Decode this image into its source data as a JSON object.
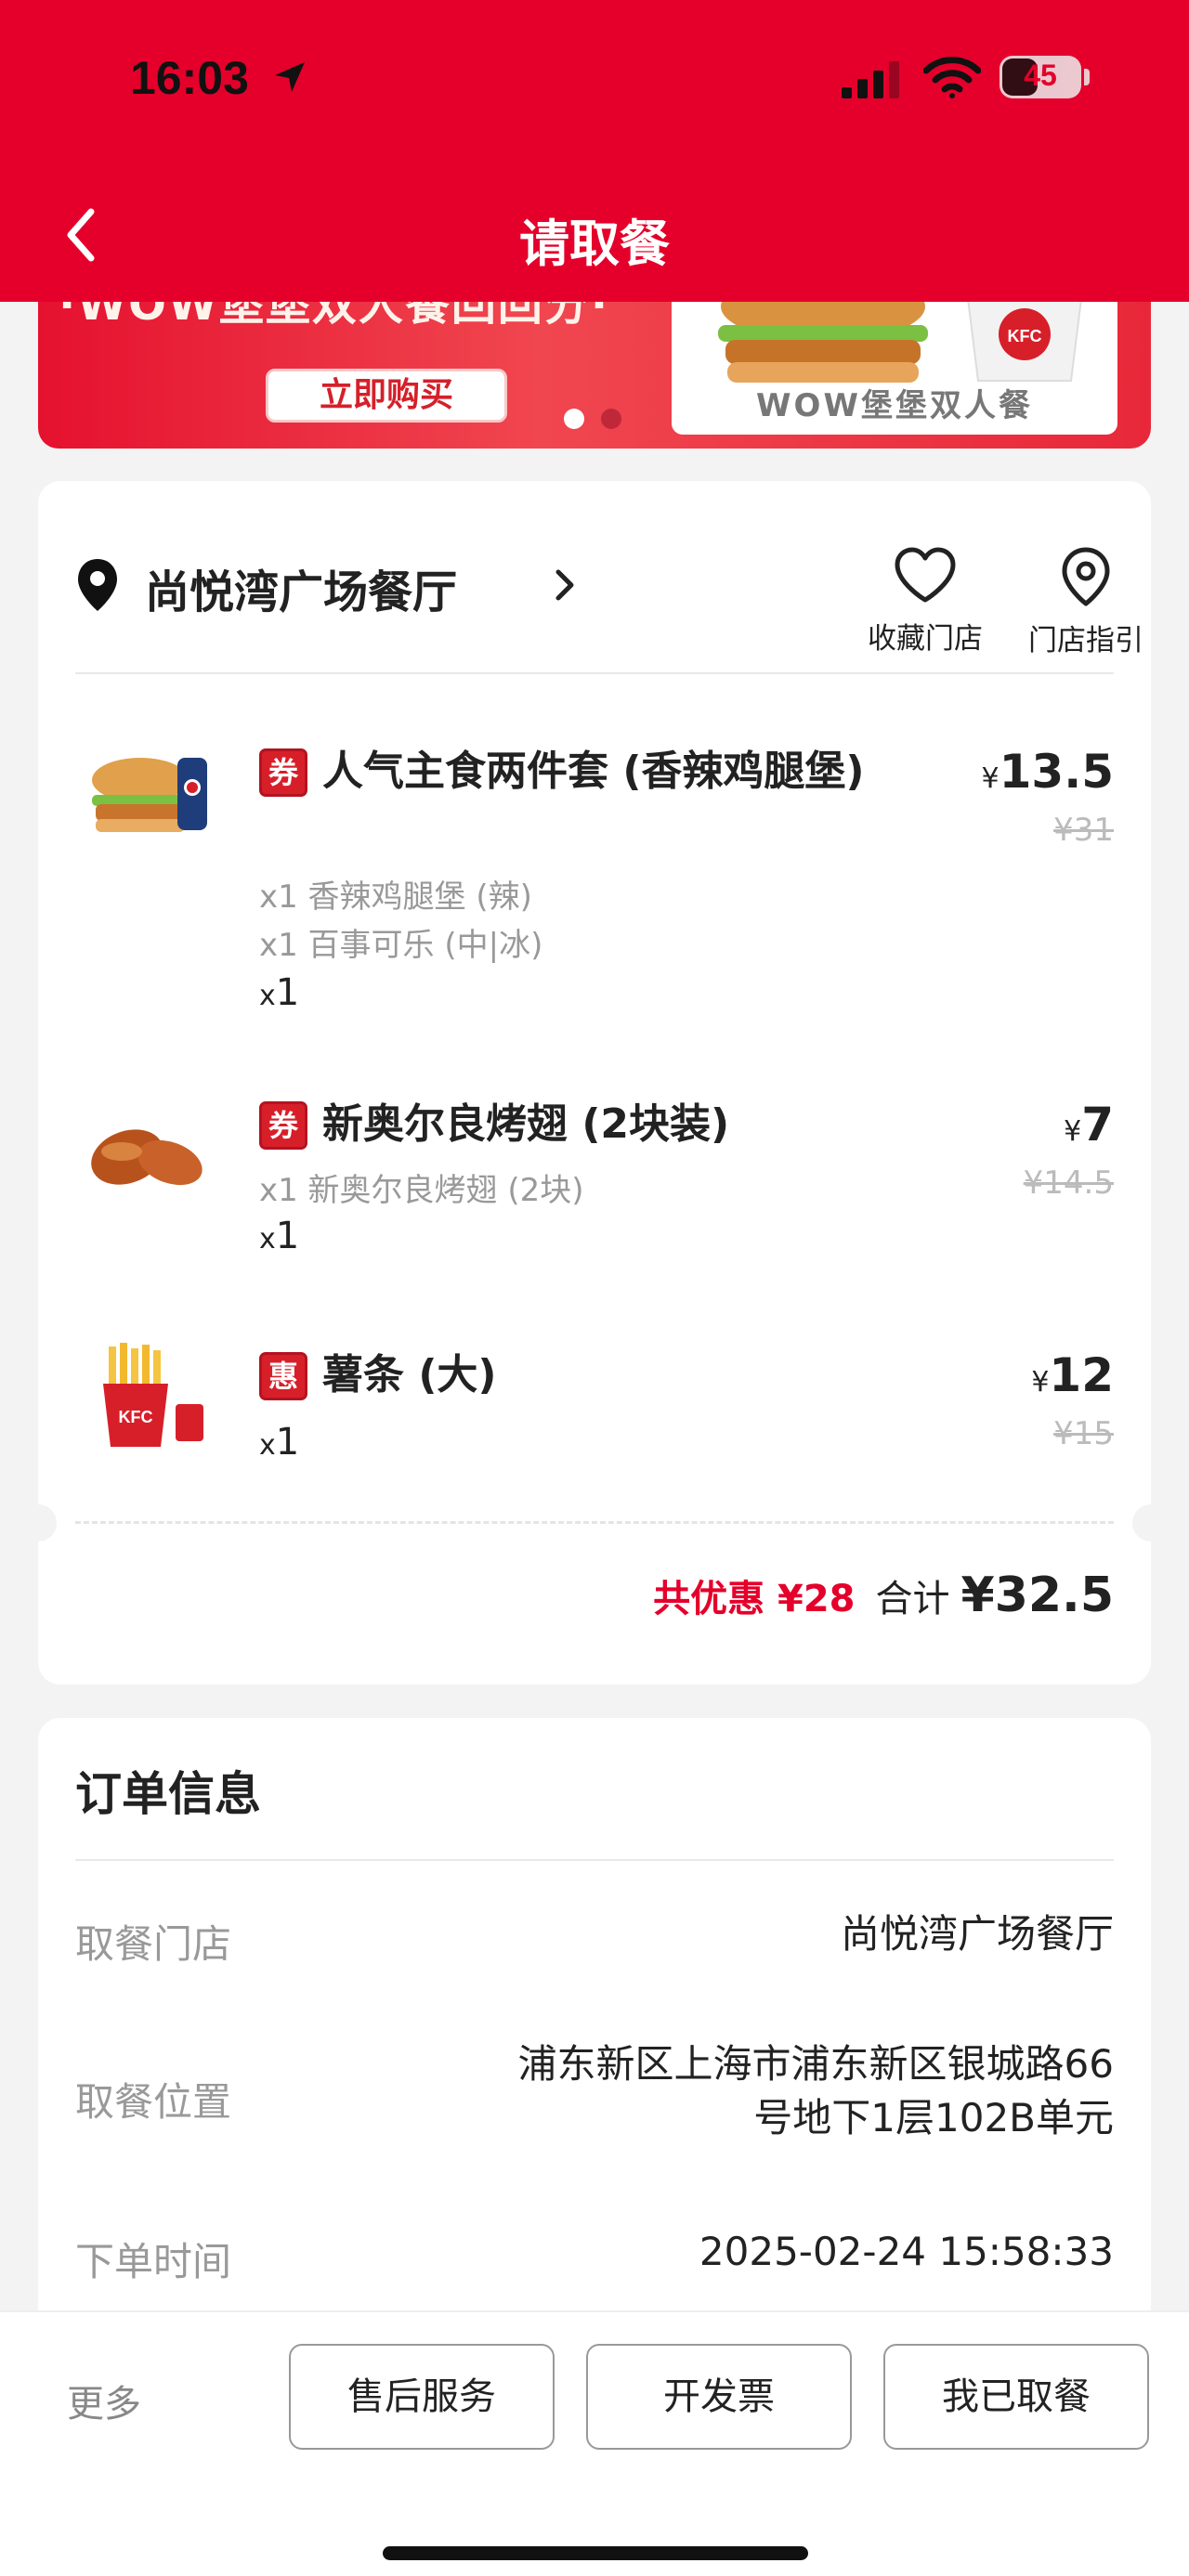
{
  "status_bar": {
    "time": "16:03",
    "battery": "45"
  },
  "header": {
    "title": "请取餐"
  },
  "banner": {
    "slogan": "·WOW堡堡双人餐回回分·",
    "buy_label": "立即购买",
    "card_label": "WOW堡堡双人餐"
  },
  "store": {
    "name": "尚悦湾广场餐厅",
    "fav_label": "收藏门店",
    "guide_label": "门店指引"
  },
  "items": [
    {
      "tag": "券",
      "name": "人气主食两件套 (香辣鸡腿堡)",
      "options": [
        "x1 香辣鸡腿堡 (辣)",
        "x1 百事可乐 (中|冰)"
      ],
      "qty": "1",
      "price": "13.5",
      "original_price": "¥31"
    },
    {
      "tag": "券",
      "name": "新奥尔良烤翅 (2块装)",
      "options": [
        "x1 新奥尔良烤翅 (2块)"
      ],
      "qty": "1",
      "price": "7",
      "original_price": "¥14.5"
    },
    {
      "tag": "惠",
      "name": "薯条 (大)",
      "options": [],
      "qty": "1",
      "price": "12",
      "original_price": "¥15"
    }
  ],
  "totals": {
    "discount": "共优惠 ¥28",
    "total_label": "合计",
    "total_value": "¥32.5"
  },
  "order_info": {
    "title": "订单信息",
    "rows": [
      {
        "label": "取餐门店",
        "value": "尚悦湾广场餐厅"
      },
      {
        "label": "取餐位置",
        "value_line1": "浦东新区上海市浦东新区银城路66",
        "value_line2": "号地下1层102B单元"
      },
      {
        "label": "下单时间",
        "value": "2025-02-24 15:58:33"
      }
    ]
  },
  "bottom_bar": {
    "more": "更多",
    "after_sales": "售后服务",
    "invoice": "开发票",
    "picked_up": "我已取餐"
  },
  "colors": {
    "brand_red": "#e4002b",
    "muted_text": "#999999"
  }
}
